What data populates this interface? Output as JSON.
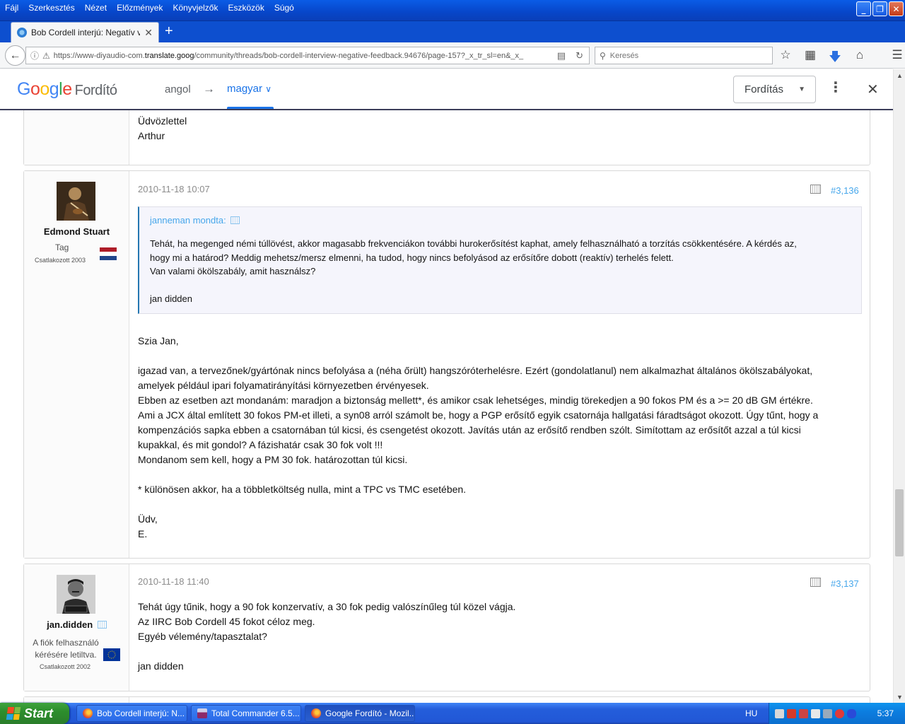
{
  "menubar": {
    "items": [
      {
        "label": "Fájl"
      },
      {
        "label": "Szerkesztés"
      },
      {
        "label": "Nézet"
      },
      {
        "label": "Előzmények"
      },
      {
        "label": "Könyvjelzők"
      },
      {
        "label": "Eszközök"
      },
      {
        "label": "Súgó"
      }
    ]
  },
  "window_controls": {
    "minimize": "_",
    "restore": "❐",
    "close": "✕"
  },
  "tab": {
    "title": "Bob Cordell interjú: Negatív vi...",
    "close": "✕",
    "new_tab": "+"
  },
  "urlbar": {
    "url_prefix": "https://www-diyaudio-com.",
    "url_domain": "translate.goog",
    "url_suffix": "/community/threads/bob-cordell-interview-negative-feedback.94676/page-157?_x_tr_sl=en&_x_"
  },
  "search": {
    "placeholder": "Keresés"
  },
  "translate_bar": {
    "logo_google": [
      "G",
      "o",
      "o",
      "g",
      "l",
      "e"
    ],
    "logo_label": "Fordító",
    "source_lang": "angol",
    "arrow": "→",
    "target_lang": "magyar",
    "mode_label": "Fordítás",
    "colors": {
      "blue": "#4285f4",
      "red": "#ea4335",
      "yellow": "#fbbc05",
      "green": "#34a853",
      "accent": "#1a73e8"
    }
  },
  "prev_post": {
    "lines": [
      "Üdvözlettel",
      "Arthur"
    ]
  },
  "post1": {
    "author": "Edmond Stuart",
    "user_title": "Tag",
    "joined": "Csatlakozott 2003",
    "date": "2010-11-18 10:07",
    "number": "#3,136",
    "quote": {
      "header": "janneman mondta:",
      "lines": [
        "Tehát, ha megenged némi túllövést, akkor magasabb frekvenciákon további hurokerősítést kaphat, amely felhasználható a torzítás csökkentésére. A kérdés az,",
        "hogy mi a határod? Meddig mehetsz/mersz elmenni, ha tudod, hogy nincs befolyásod az erősítőre dobott (reaktív) terhelés felett.",
        "Van valami ökölszabály, amit használsz?",
        "",
        "jan didden"
      ]
    },
    "lines": [
      "Szia Jan,",
      "",
      "igazad van, a tervezőnek/gyártónak nincs befolyása a (néha őrült) hangszóróterhelésre. Ezért (gondolatlanul) nem alkalmazhat általános ökölszabályokat,",
      "amelyek például ipari folyamatirányítási környezetben érvényesek.",
      "Ebben az esetben azt mondanám: maradjon a biztonság mellett*, és amikor csak lehetséges, mindig törekedjen a 90 fokos PM és a >= 20 dB GM értékre.",
      "Ami a JCX által említett 30 fokos PM-et illeti, a syn08 arról számolt be, hogy a PGP erősítő egyik csatornája hallgatási fáradtságot okozott. Úgy tűnt, hogy a",
      "kompenzációs sapka ebben a csatornában túl kicsi, és csengetést okozott. Javítás után az erősítő rendben szólt. Simítottam az erősítőt azzal a túl kicsi",
      "kupakkal, és mit gondol? A fázishatár csak 30 fok volt !!!",
      "Mondanom sem kell, hogy a PM 30 fok. határozottan túl kicsi.",
      "",
      "* különösen akkor, ha a többletköltség nulla, mint a TPC vs TMC esetében.",
      "",
      "Üdv,",
      "E."
    ]
  },
  "post2": {
    "author": "jan.didden",
    "user_title_lines": [
      "A fiók felhasználó",
      "kérésére letiltva."
    ],
    "joined": "Csatlakozott 2002",
    "date": "2010-11-18 11:40",
    "number": "#3,137",
    "lines": [
      "Tehát úgy tűnik, hogy a 90 fok konzervatív, a 30 fok pedig valószínűleg túl közel vágja.",
      "Az IIRC Bob Cordell 45 fokot céloz meg.",
      "Egyéb vélemény/tapasztalat?",
      "",
      "jan didden"
    ]
  },
  "taskbar": {
    "start_label": "Start",
    "buttons": [
      {
        "label": "Bob Cordell interjú: N..."
      },
      {
        "label": "Total Commander 6.5..."
      },
      {
        "label": "Google Fordító - Mozil..."
      }
    ],
    "lang": "HU",
    "clock": "5:37"
  }
}
